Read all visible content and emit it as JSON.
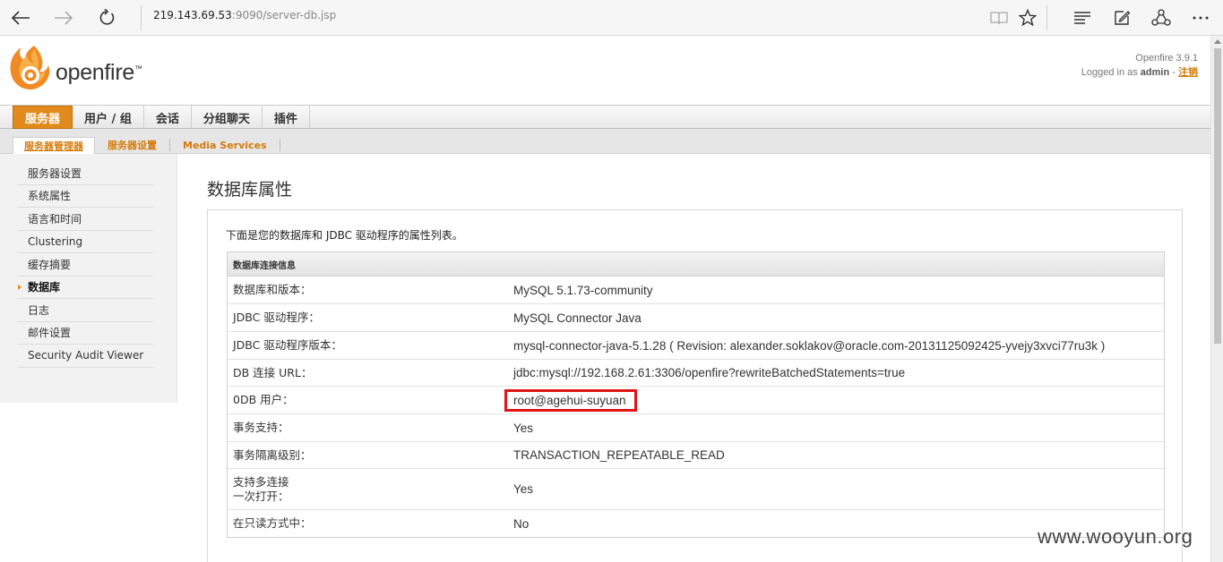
{
  "browser": {
    "url_host": "219.143.69.53",
    "url_rest": ":9090/server-db.jsp",
    "icons": [
      "back-arrow-icon",
      "forward-arrow-icon",
      "refresh-icon",
      "reading-view-icon",
      "favorite-star-icon",
      "hub-icon",
      "web-note-icon",
      "share-icon",
      "more-icon"
    ]
  },
  "header": {
    "logo_text": "openfire",
    "logo_tm": "™",
    "version": "Openfire 3.9.1",
    "logged_in_prefix": "Logged in as",
    "username": "admin",
    "separator": "-",
    "logout": "注销"
  },
  "tabs": [
    {
      "label": "服务器",
      "active": true
    },
    {
      "label": "用户 / 组",
      "active": false
    },
    {
      "label": "会话",
      "active": false
    },
    {
      "label": "分组聊天",
      "active": false
    },
    {
      "label": "插件",
      "active": false
    }
  ],
  "subtabs": [
    {
      "label": "服务器管理器",
      "active": true
    },
    {
      "label": "服务器设置",
      "active": false
    },
    {
      "label": "Media Services",
      "active": false
    }
  ],
  "sidebar": {
    "items": [
      {
        "label": "服务器设置",
        "active": false
      },
      {
        "label": "系统属性",
        "active": false
      },
      {
        "label": "语言和时间",
        "active": false
      },
      {
        "label": "Clustering",
        "active": false
      },
      {
        "label": "缓存摘要",
        "active": false
      },
      {
        "label": "数据库",
        "active": true
      },
      {
        "label": "日志",
        "active": false
      },
      {
        "label": "邮件设置",
        "active": false
      },
      {
        "label": "Security Audit Viewer",
        "active": false
      }
    ]
  },
  "main": {
    "title": "数据库属性",
    "intro": "下面是您的数据库和 JDBC 驱动程序的属性列表。",
    "table_header": "数据库连接信息",
    "rows": [
      {
        "label": "数据库和版本：",
        "value": "MySQL 5.1.73-community",
        "highlight": false
      },
      {
        "label": "JDBC 驱动程序：",
        "value": "MySQL Connector Java",
        "highlight": false
      },
      {
        "label": "JDBC 驱动程序版本：",
        "value": "mysql-connector-java-5.1.28 ( Revision: alexander.soklakov@oracle.com-20131125092425-yvejy3xvci77ru3k )",
        "highlight": false
      },
      {
        "label": "DB 连接 URL：",
        "value": "jdbc:mysql://192.168.2.61:3306/openfire?rewriteBatchedStatements=true",
        "highlight": false
      },
      {
        "label": "0DB 用户：",
        "value": "root@agehui-suyuan",
        "highlight": true
      },
      {
        "label": "事务支持：",
        "value": "Yes",
        "highlight": false
      },
      {
        "label": "事务隔离级别：",
        "value": "TRANSACTION_REPEATABLE_READ",
        "highlight": false
      },
      {
        "label": "支持多连接\n一次打开：",
        "value": "Yes",
        "highlight": false
      },
      {
        "label": "在只读方式中：",
        "value": "No",
        "highlight": false
      }
    ]
  },
  "watermark": "www.wooyun.org",
  "colors": {
    "accent": "#e28b1c",
    "link": "#d47b0b",
    "highlight_border": "#e01515"
  }
}
